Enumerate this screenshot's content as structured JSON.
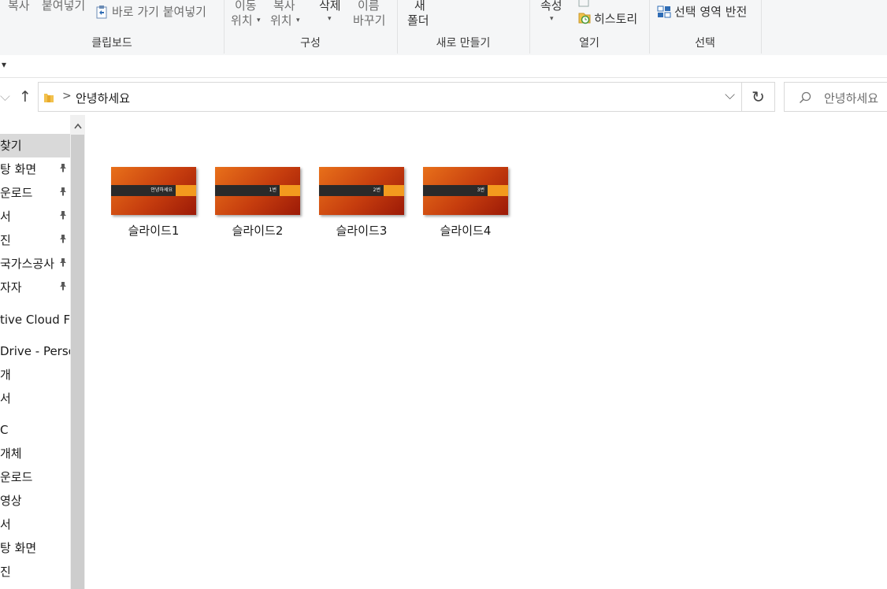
{
  "ribbon": {
    "copy_label": "복사",
    "paste_label": "붙여넣기",
    "paste_shortcut_label": "바로 가기 붙여넣기",
    "move_to_label": [
      "이동",
      "위치"
    ],
    "copy_to_label": [
      "복사",
      "위치"
    ],
    "delete_label": "삭제",
    "rename_label": [
      "이름",
      "바꾸기"
    ],
    "new_folder_label": [
      "새",
      "폴더"
    ],
    "properties_label": "속성",
    "history_label": "히스토리",
    "invert_selection_label": "선택 영역 반전",
    "groups": {
      "clipboard": "클립보드",
      "organize": "구성",
      "new": "새로 만들기",
      "open": "열기",
      "select": "선택"
    }
  },
  "quick_access_caret": "▾",
  "address_bar": {
    "back_glyph": "⌵",
    "up_glyph": "↑",
    "separator": ">",
    "path": "안녕하세요",
    "dropdown_glyph": "⌵",
    "refresh_glyph": "↻",
    "search_placeholder": "안녕하세요"
  },
  "nav_pane": {
    "items": [
      {
        "label": "찾기",
        "pinned": false,
        "selected": true
      },
      {
        "label": "탕 화면",
        "pinned": true
      },
      {
        "label": "운로드",
        "pinned": true
      },
      {
        "label": "서",
        "pinned": true
      },
      {
        "label": "진",
        "pinned": true
      },
      {
        "label": "국가스공사",
        "pinned": true
      },
      {
        "label": "자자",
        "pinned": true
      },
      {
        "label": "tive Cloud Fil",
        "pinned": false
      },
      {
        "label": "Drive - Perso",
        "pinned": false
      },
      {
        "label": "개",
        "pinned": false
      },
      {
        "label": "서",
        "pinned": false
      },
      {
        "label": "C",
        "pinned": false
      },
      {
        "label": " 개체",
        "pinned": false
      },
      {
        "label": "운로드",
        "pinned": false
      },
      {
        "label": "영상",
        "pinned": false
      },
      {
        "label": "서",
        "pinned": false
      },
      {
        "label": "탕 화면",
        "pinned": false
      },
      {
        "label": "진",
        "pinned": false
      }
    ],
    "pin_glyph": "📌",
    "scroll_up_glyph": "⌃"
  },
  "files": [
    {
      "name": "슬라이드1",
      "thumb_text": "안녕하세요"
    },
    {
      "name": "슬라이드2",
      "thumb_text": "1번"
    },
    {
      "name": "슬라이드3",
      "thumb_text": "2번"
    },
    {
      "name": "슬라이드4",
      "thumb_text": "3번"
    }
  ],
  "colors": {
    "thumb_accent": "#f39a1e",
    "thumb_bar": "#2a2a2a",
    "selection": "#d9d9d9"
  }
}
